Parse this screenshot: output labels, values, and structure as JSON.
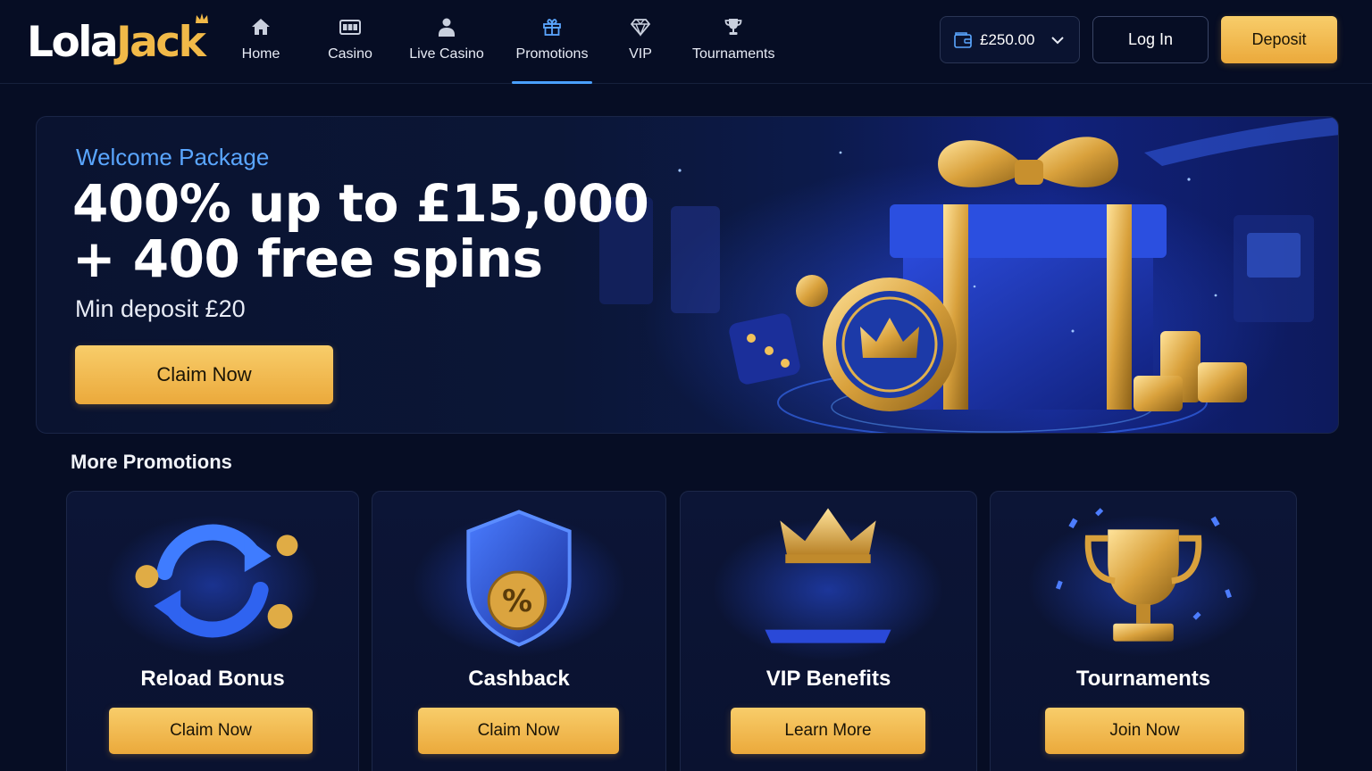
{
  "brand": {
    "name_part1": "Lola",
    "name_part2": "Jack"
  },
  "nav": [
    {
      "label": "Home",
      "icon": "home-icon"
    },
    {
      "label": "Casino",
      "icon": "slot-machine-icon"
    },
    {
      "label": "Live Casino",
      "icon": "dealer-icon"
    },
    {
      "label": "Promotions",
      "icon": "gift-icon",
      "active": true
    },
    {
      "label": "VIP",
      "icon": "diamond-icon"
    },
    {
      "label": "Tournaments",
      "icon": "trophy-icon"
    }
  ],
  "account": {
    "balance": "£250.00",
    "login_label": "Log In",
    "deposit_label": "Deposit"
  },
  "hero": {
    "kicker": "Welcome Package",
    "title_line1": "400% up to £15,000",
    "title_line2": "+ 400 free spins",
    "min_deposit": "Min deposit £20",
    "cta": "Claim Now"
  },
  "promotions": {
    "section_title": "More Promotions",
    "cards": [
      {
        "title": "Reload Bonus",
        "cta": "Claim Now",
        "icon": "reload-arrows-icon"
      },
      {
        "title": "Cashback",
        "cta": "Claim Now",
        "icon": "shield-percent-icon"
      },
      {
        "title": "VIP Benefits",
        "cta": "Learn More",
        "icon": "vip-crown-icon"
      },
      {
        "title": "Tournaments",
        "cta": "Join Now",
        "icon": "trophy-cup-icon"
      }
    ]
  },
  "colors": {
    "background": "#060d24",
    "accent_blue": "#4aa0ff",
    "gold": "#f1b948",
    "button_gold_top": "#f8cd6a",
    "button_gold_bottom": "#eba93b"
  }
}
